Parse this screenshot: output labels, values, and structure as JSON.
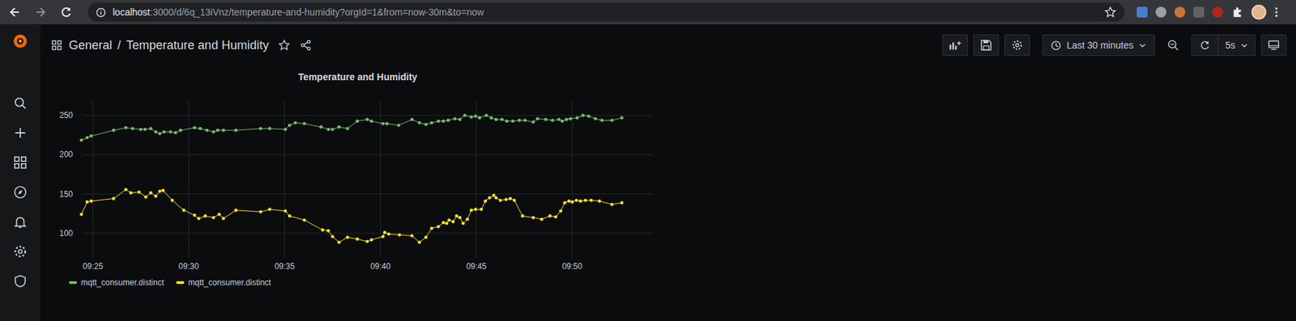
{
  "browser": {
    "url_host": "localhost",
    "url_path": ":3000/d/6q_13iVnz/temperature-and-humidity?orgId=1&from=now-30m&to=now",
    "bookmarked": false
  },
  "header": {
    "folder": "General",
    "separator": "/",
    "title": "Temperature and Humidity",
    "starred": false
  },
  "time_picker": {
    "label": "Last 30 minutes"
  },
  "refresh": {
    "interval": "5s"
  },
  "panel": {
    "title": "Temperature and Humidity",
    "y_ticks": [
      "250",
      "200",
      "150",
      "100"
    ],
    "x_ticks": [
      "09:25",
      "09:30",
      "09:35",
      "09:40",
      "09:45",
      "09:50"
    ],
    "series": [
      {
        "name": "mqtt_consumer.distinct",
        "color": "#73bf69",
        "times": [
          564.4,
          564.7,
          564.91,
          566.08,
          566.72,
          567.07,
          567.5,
          567.72,
          568.02,
          568.28,
          568.49,
          568.71,
          569.05,
          569.31,
          569.57,
          570.3,
          570.6,
          570.95,
          571.29,
          571.51,
          571.81,
          572.46,
          573.75,
          574.22,
          575.04,
          575.26,
          575.56,
          576.03,
          576.9,
          577.28,
          577.5,
          577.84,
          578.28,
          578.79,
          579.31,
          579.53,
          580.13,
          580.34,
          580.95,
          581.64,
          582.03,
          582.37,
          582.67,
          583.02,
          583.28,
          583.53,
          583.88,
          584.14,
          584.4,
          584.74,
          584.96,
          585.17,
          585.52,
          585.78,
          586.03,
          586.34,
          586.59,
          586.9,
          587.24,
          587.54,
          587.97,
          588.19,
          588.62,
          588.97,
          589.31,
          589.48,
          589.7,
          589.91,
          590.26,
          590.56,
          590.86,
          591.21,
          591.55,
          592.07,
          592.59
        ],
        "values": [
          218.5,
          221.7,
          223.8,
          231.1,
          234.3,
          233.2,
          232.2,
          232.2,
          233.2,
          229,
          226.9,
          229,
          229,
          228,
          231.1,
          234.3,
          233.2,
          231.1,
          229,
          231.1,
          231.1,
          231.1,
          233.2,
          233.2,
          232.2,
          237.4,
          240.6,
          239.5,
          235.3,
          232.2,
          232.2,
          235.3,
          233.2,
          242.7,
          244.8,
          242.7,
          239.5,
          239.5,
          237.4,
          244.8,
          240.6,
          238.5,
          240.6,
          242.7,
          242.7,
          243.7,
          245.8,
          244.8,
          250,
          247.9,
          249,
          246.9,
          250,
          246.9,
          244.8,
          244.8,
          242.7,
          242.7,
          243.7,
          243.7,
          241.6,
          245.8,
          244.8,
          243.7,
          244.8,
          242.7,
          244.8,
          245.8,
          246.9,
          250,
          249,
          245.8,
          243.7,
          243.7,
          246.9
        ]
      },
      {
        "name": "mqtt_consumer.distinct",
        "color": "#fade2a",
        "times": [
          564.4,
          564.7,
          564.91,
          566.08,
          566.72,
          566.98,
          567.41,
          567.76,
          568.02,
          568.28,
          568.49,
          568.66,
          569.14,
          569.74,
          570.3,
          570.52,
          570.86,
          571.29,
          571.59,
          571.81,
          572.46,
          573.75,
          574.22,
          575.04,
          575.26,
          576.03,
          576.98,
          577.28,
          577.5,
          577.84,
          578.28,
          578.79,
          579.31,
          579.53,
          580.13,
          580.22,
          580.43,
          580.99,
          581.64,
          582.03,
          582.37,
          582.67,
          583.02,
          583.28,
          583.45,
          583.58,
          583.79,
          583.97,
          584.14,
          584.31,
          584.53,
          584.74,
          584.96,
          585.26,
          585.47,
          585.69,
          585.91,
          586.03,
          586.25,
          586.55,
          586.77,
          586.98,
          587.41,
          587.97,
          588.41,
          588.84,
          589.14,
          589.4,
          589.61,
          589.83,
          590.0,
          590.22,
          590.43,
          590.69,
          590.99,
          591.42,
          592.07,
          592.59
        ],
        "values": [
          124.1,
          139.8,
          140.9,
          144.1,
          155.6,
          151.4,
          152.4,
          146.1,
          151.4,
          147.2,
          153.5,
          154.5,
          141.9,
          129.3,
          123,
          118.8,
          122,
          119.9,
          124.1,
          118.8,
          129.3,
          127.3,
          130.4,
          128.3,
          122,
          116.8,
          104.2,
          103.1,
          95.8,
          88.5,
          94.8,
          92.6,
          89.5,
          91.6,
          95.8,
          101,
          99,
          97.9,
          96.8,
          88.5,
          94.8,
          106.3,
          108.4,
          113.6,
          112.6,
          116.8,
          114.7,
          122,
          119.9,
          112.6,
          117.8,
          129.3,
          130.4,
          130.4,
          140.9,
          145.1,
          148.2,
          145.1,
          141.9,
          143,
          144.1,
          141.9,
          122,
          119.9,
          117.8,
          122,
          120.9,
          128.3,
          138.8,
          140.9,
          139.8,
          141.9,
          140.9,
          141.9,
          141.9,
          140.9,
          136.7,
          138.8
        ]
      }
    ]
  }
}
